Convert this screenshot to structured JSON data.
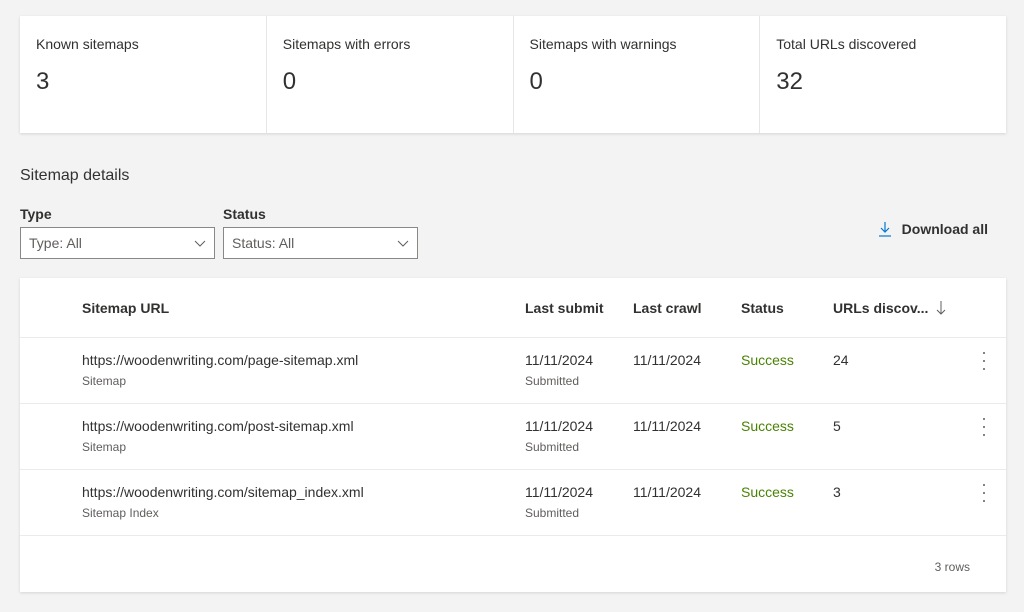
{
  "summary_cards": [
    {
      "label": "Known sitemaps",
      "value": "3"
    },
    {
      "label": "Sitemaps with errors",
      "value": "0"
    },
    {
      "label": "Sitemaps with warnings",
      "value": "0"
    },
    {
      "label": "Total URLs discovered",
      "value": "32"
    }
  ],
  "section_title": "Sitemap details",
  "filters": {
    "type": {
      "label": "Type",
      "value": "Type: All"
    },
    "status": {
      "label": "Status",
      "value": "Status: All"
    }
  },
  "download_all": {
    "label": "Download all",
    "icon": "download-icon"
  },
  "table": {
    "columns": {
      "url": "Sitemap URL",
      "last_submit": "Last submit",
      "last_crawl": "Last crawl",
      "status": "Status",
      "urls_discovered": "URLs discov...",
      "sort_icon": "arrow-down-icon"
    },
    "rows": [
      {
        "url": "https://woodenwriting.com/page-sitemap.xml",
        "type": "Sitemap",
        "last_submit": "11/11/2024",
        "submit_note": "Submitted",
        "last_crawl": "11/11/2024",
        "status": "Success",
        "urls": "24"
      },
      {
        "url": "https://woodenwriting.com/post-sitemap.xml",
        "type": "Sitemap",
        "last_submit": "11/11/2024",
        "submit_note": "Submitted",
        "last_crawl": "11/11/2024",
        "status": "Success",
        "urls": "5"
      },
      {
        "url": "https://woodenwriting.com/sitemap_index.xml",
        "type": "Sitemap Index",
        "last_submit": "11/11/2024",
        "submit_note": "Submitted",
        "last_crawl": "11/11/2024",
        "status": "Success",
        "urls": "3"
      }
    ],
    "row_count": "3 rows"
  },
  "colors": {
    "success": "#498205",
    "accent": "#0078d4"
  }
}
